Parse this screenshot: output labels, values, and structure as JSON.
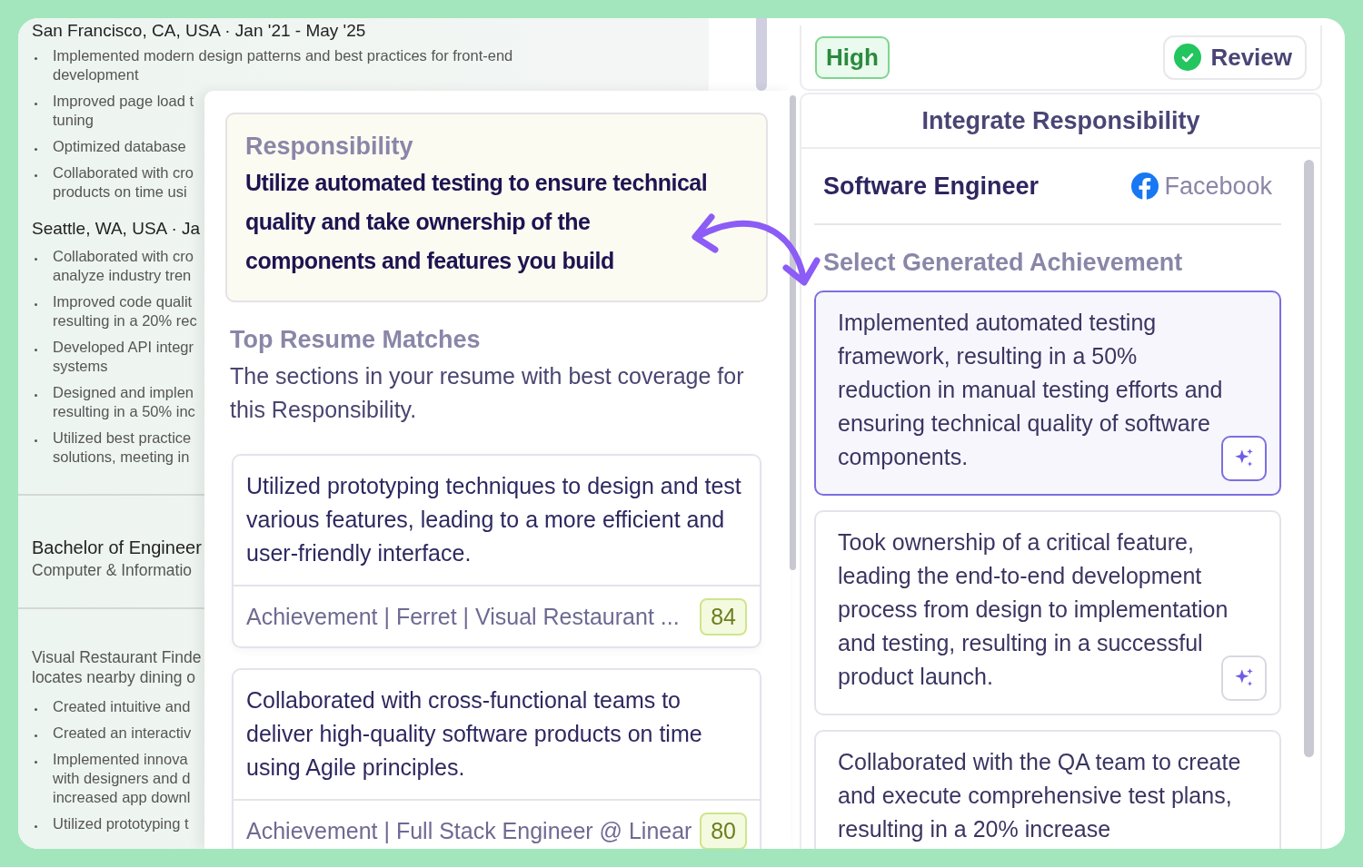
{
  "resume": {
    "items": [
      {
        "kind": "meta",
        "lines": [
          "San Francisco, CA, USA · Jan '21 - May '25"
        ]
      },
      {
        "kind": "bullet",
        "lines": [
          "Implemented modern design patterns and best practices for front-end",
          "development"
        ]
      },
      {
        "kind": "bullet",
        "lines": [
          "Improved page load t",
          "tuning"
        ]
      },
      {
        "kind": "bullet",
        "lines": [
          "Optimized database"
        ]
      },
      {
        "kind": "bullet",
        "lines": [
          "Collaborated with cro",
          "products on time usi"
        ]
      },
      {
        "kind": "meta",
        "lines": [
          "Seattle, WA, USA · Ja"
        ]
      },
      {
        "kind": "bullet",
        "lines": [
          "Collaborated with cro",
          "analyze industry tren"
        ]
      },
      {
        "kind": "bullet",
        "lines": [
          "Improved code qualit",
          "resulting in a 20% rec"
        ]
      },
      {
        "kind": "bullet",
        "lines": [
          "Developed API integr",
          "systems"
        ]
      },
      {
        "kind": "bullet",
        "lines": [
          "Designed and implen",
          "resulting in a 50% inc"
        ]
      },
      {
        "kind": "bullet",
        "lines": [
          "Utilized best practice",
          "solutions, meeting in"
        ]
      },
      {
        "kind": "divider"
      },
      {
        "kind": "title",
        "lines": [
          "Bachelor of Engineer"
        ]
      },
      {
        "kind": "subtitle",
        "lines": [
          "Computer & Informatio"
        ]
      },
      {
        "kind": "divider"
      },
      {
        "kind": "text",
        "lines": [
          "Visual Restaurant Finde",
          "locates nearby dining o"
        ]
      },
      {
        "kind": "bullet",
        "lines": [
          "Created intuitive and"
        ]
      },
      {
        "kind": "bullet",
        "lines": [
          "Created an interactiv"
        ]
      },
      {
        "kind": "bullet",
        "lines": [
          "Implemented innova",
          "with designers and d",
          "increased app downl"
        ]
      },
      {
        "kind": "bullet",
        "lines": [
          "Utilized prototyping t"
        ]
      }
    ]
  },
  "responsibility": {
    "label": "Responsibility",
    "text": "Utilize automated testing to ensure technical quality and take ownership of the components and features you build"
  },
  "matches": {
    "title": "Top Resume Matches",
    "description": "The sections in your resume with best coverage for this Responsibility.",
    "items": [
      {
        "text": "Utilized prototyping techniques to design and test various features, leading to a more efficient and user-friendly interface.",
        "source": "Achievement | Ferret | Visual Restaurant ...",
        "score": "84"
      },
      {
        "text": "Collaborated with cross-functional teams to deliver high-quality software products on time using Agile principles.",
        "source": "Achievement | Full Stack Engineer @ Linear",
        "score": "80"
      }
    ]
  },
  "review_bar": {
    "priority": "High",
    "review_button": "Review"
  },
  "integrate": {
    "title": "Integrate Responsibility",
    "role": "Software Engineer",
    "company": "Facebook",
    "section_title": "Select Generated Achievement",
    "achievements": [
      {
        "text": "Implemented automated testing framework, resulting in a 50% reduction in manual testing efforts and ensuring technical quality of software components.",
        "selected": true
      },
      {
        "text": "Took ownership of a critical feature, leading the end-to-end development process from design to implementation and testing, resulting in a successful product launch.",
        "selected": false
      },
      {
        "text": "Collaborated with the QA team to create and execute comprehensive test plans, resulting in a 20% increase",
        "selected": false
      }
    ]
  }
}
